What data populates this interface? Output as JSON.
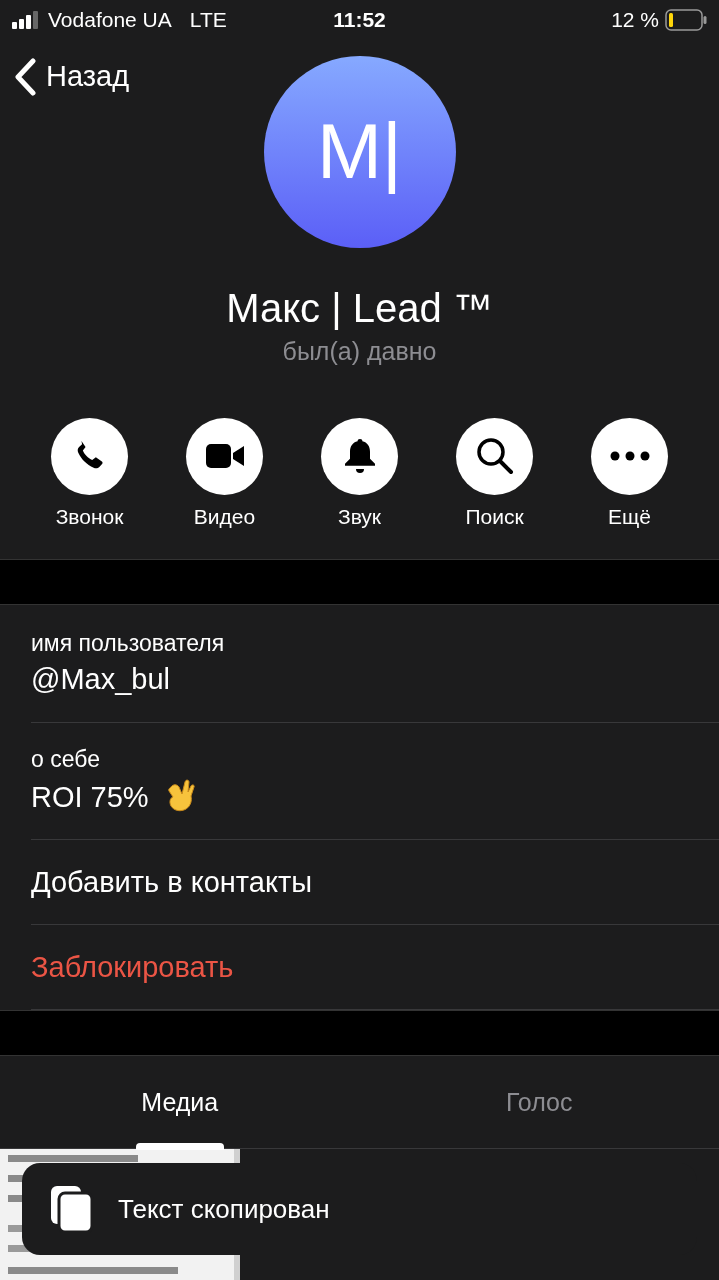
{
  "status_bar": {
    "carrier": "Vodafone UA",
    "network": "LTE",
    "time": "11:52",
    "battery": "12 %"
  },
  "nav": {
    "back": "Назад"
  },
  "profile": {
    "initials": "М|",
    "name": "Макс | Lead ™",
    "status": "был(а) давно"
  },
  "actions": [
    {
      "kind": "call",
      "label": "Звонок"
    },
    {
      "kind": "video",
      "label": "Видео"
    },
    {
      "kind": "sound",
      "label": "Звук"
    },
    {
      "kind": "search",
      "label": "Поиск"
    },
    {
      "kind": "more",
      "label": "Ещё"
    }
  ],
  "info": [
    {
      "kind": "field",
      "label": "имя пользователя",
      "value": "@Max_bul"
    },
    {
      "kind": "about",
      "label": "о себе",
      "value": "ROI 75%"
    },
    {
      "kind": "action",
      "value": "Добавить в контакты",
      "destructive": false
    },
    {
      "kind": "action",
      "value": "Заблокировать",
      "destructive": true
    }
  ],
  "tabs": [
    {
      "label": "Медиа",
      "selected": true
    },
    {
      "label": "Голос",
      "selected": false
    }
  ],
  "toast": {
    "text": "Текст скопирован"
  }
}
